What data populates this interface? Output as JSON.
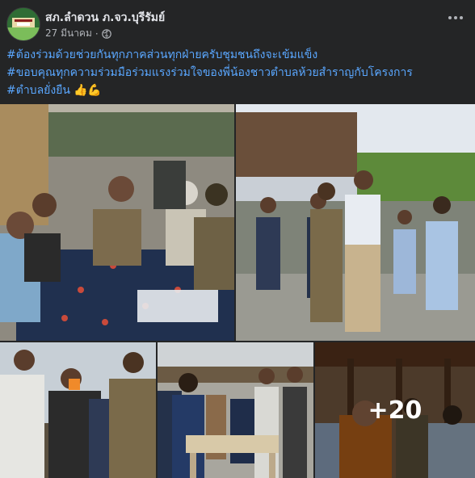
{
  "post": {
    "page_name": "สภ.ลำดวน ภ.จว.บุรีรัมย์",
    "date": "27 มีนาคม",
    "separator": "·",
    "privacy_icon": "globe-icon",
    "more_icon": "more-horizontal-icon",
    "text_lines": [
      {
        "tag": "#ต้องร่วมด้วยช่วยกันทุกภาคส่วนทุกฝ่ายครับชุมชนถึงจะเข้มแข็ง",
        "suffix": ""
      },
      {
        "tag": "#ขอบคุณทุกความร่วมมือร่วมแรงร่วมใจของพี่น้องชาวตำบลห้วยสำราญกับโครงการ",
        "suffix": ""
      },
      {
        "tag": "#ตำบลยั่งยืน",
        "suffix": "👍💪"
      }
    ]
  },
  "photos": {
    "more_count": "+20",
    "items": [
      {
        "name": "photo-meeting-table",
        "description": "officers with villagers at table"
      },
      {
        "name": "photo-village-walk",
        "description": "officials walking in village street"
      },
      {
        "name": "photo-officers-group",
        "description": "officers standing outdoors"
      },
      {
        "name": "photo-food-table",
        "description": "people at food table"
      },
      {
        "name": "photo-monk-ceremony",
        "description": "monk with community"
      }
    ]
  },
  "colors": {
    "background": "#242526",
    "hashtag": "#5aa7ff",
    "text": "#e4e6eb",
    "secondary_text": "#b0b3b8"
  }
}
